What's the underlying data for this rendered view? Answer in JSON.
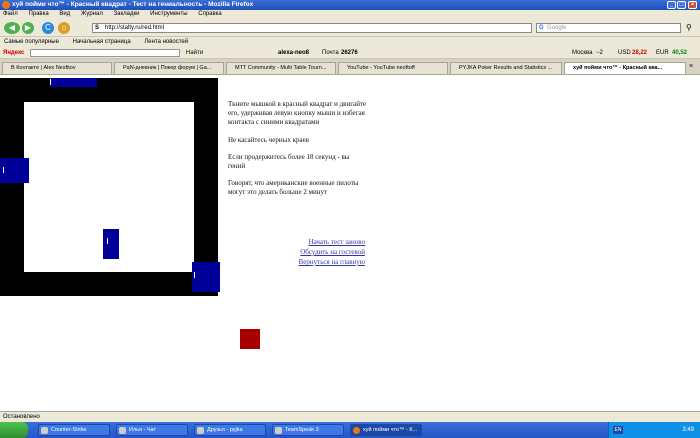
{
  "window": {
    "title": "хуй пойми что™ - Красный квадрат - Тест на гениальность - Mozilla Firefox",
    "minimize": "_",
    "maximize": "□",
    "close": "×"
  },
  "menu": [
    "Файл",
    "Правка",
    "Вид",
    "Журнал",
    "Закладки",
    "Инструменты",
    "Справка"
  ],
  "nav": {
    "url": "http://stalty.ru/red.html",
    "search_placeholder": "Google",
    "back": "◀",
    "forward": "▶",
    "reload": "C",
    "home": "⌂"
  },
  "bookmarks": [
    "Самые популярные",
    "Начальная страница",
    "Лента новостей"
  ],
  "yandex": {
    "brand": "Яндекс",
    "find": "Найти",
    "user": "alexa-neo8",
    "mail_label": "Почта",
    "mail_count": "26276",
    "weather_city": "Москва",
    "temp": "−2",
    "usd_label": "USD",
    "usd": "28,22",
    "eur_label": "EUR",
    "eur": "40,52"
  },
  "tabs": [
    {
      "label": "В Контакте | Alex Nesfitov"
    },
    {
      "label": "PaN-дневник | Покер форум | Ga..."
    },
    {
      "label": "MTT Community - Multi Table Tourn..."
    },
    {
      "label": "YouTube - YouTube neoftoff"
    },
    {
      "label": "PYJKA Poker Results and Statistics ..."
    },
    {
      "label": "хуй пойми что™ - Красный ква..."
    }
  ],
  "page": {
    "instructions": [
      "Ткните мышкой в красный квадрат и двигайте его, удерживая левую кнопку мыши и избегая контакта с синими квадратами",
      "Не касайтесь черных краев",
      "Если продержитесь более 18 секунд - вы гений",
      "Говорят, что американские военные пилоты могут это делать больше 2 минут"
    ],
    "links": [
      "Начать тест заново",
      "Обсудить на гостевой",
      "Вернуться на главную"
    ]
  },
  "status": "Остановлено",
  "taskbar": {
    "tasks": [
      "Counter-Strike",
      "Илья - Чат",
      "Друзья - pyjka",
      "TeamSpeak 3",
      "хуй пойми что™ - К..."
    ],
    "lang": "EN",
    "clock": "3:49"
  },
  "colors": {
    "enemy": "#000099",
    "player": "#a80000",
    "border": "#000000",
    "link": "#3333aa"
  }
}
